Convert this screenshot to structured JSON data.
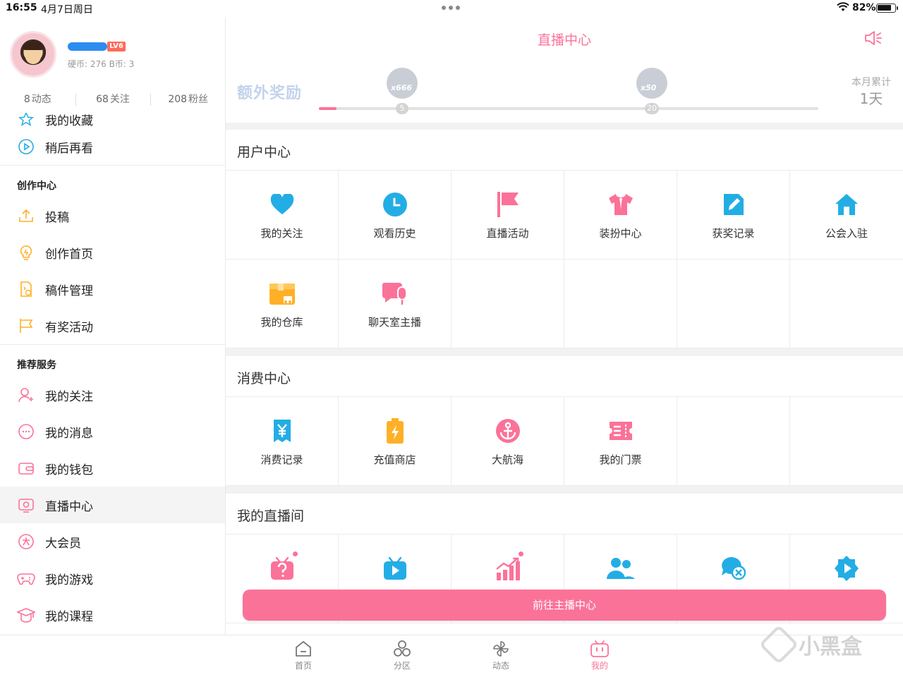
{
  "status_bar": {
    "time": "16:55",
    "date": "4月7日周日",
    "battery_pct": "82%",
    "battery_level": 0.82
  },
  "profile": {
    "level": "LV6",
    "coins": "硬币: 276  B币: 3",
    "stats": [
      {
        "value": "8",
        "label": "动态"
      },
      {
        "value": "68",
        "label": "关注"
      },
      {
        "value": "208",
        "label": "粉丝"
      }
    ]
  },
  "sidebar": {
    "top_items": [
      {
        "label": "我的收藏",
        "icon": "star-icon"
      },
      {
        "label": "稍后再看",
        "icon": "watch-later-icon"
      }
    ],
    "create_group": {
      "title": "创作中心",
      "items": [
        {
          "label": "投稿",
          "icon": "upload-icon"
        },
        {
          "label": "创作首页",
          "icon": "lightbulb-icon"
        },
        {
          "label": "稿件管理",
          "icon": "manuscript-icon"
        },
        {
          "label": "有奖活动",
          "icon": "flag-icon"
        }
      ]
    },
    "recommend_group": {
      "title": "推荐服务",
      "items": [
        {
          "label": "我的关注",
          "icon": "user-plus-icon"
        },
        {
          "label": "我的消息",
          "icon": "message-icon"
        },
        {
          "label": "我的钱包",
          "icon": "wallet-icon"
        },
        {
          "label": "直播中心",
          "icon": "live-tv-icon"
        },
        {
          "label": "大会员",
          "icon": "vip-icon"
        },
        {
          "label": "我的游戏",
          "icon": "gamepad-icon"
        },
        {
          "label": "我的课程",
          "icon": "graduation-cap-icon"
        }
      ]
    }
  },
  "main": {
    "title": "直播中心",
    "reward": {
      "title": "额外奖励",
      "progress": 0.035,
      "milestones": [
        {
          "value": "5",
          "badge": "x666"
        },
        {
          "value": "20",
          "badge": "x50"
        }
      ],
      "monthly_label": "本月累计",
      "monthly_value": "1天"
    },
    "user_center": {
      "title": "用户中心",
      "items": [
        {
          "label": "我的关注",
          "icon": "heart-icon",
          "color": "#23ade5"
        },
        {
          "label": "观看历史",
          "icon": "clock-icon",
          "color": "#23ade5"
        },
        {
          "label": "直播活动",
          "icon": "flag-icon",
          "color": "#fb7299"
        },
        {
          "label": "装扮中心",
          "icon": "shirt-icon",
          "color": "#fb7299"
        },
        {
          "label": "获奖记录",
          "icon": "edit-icon",
          "color": "#23ade5"
        },
        {
          "label": "公会入驻",
          "icon": "house-icon",
          "color": "#23ade5"
        },
        {
          "label": "我的仓库",
          "icon": "warehouse-icon",
          "color": "#ffb027"
        },
        {
          "label": "聊天室主播",
          "icon": "chat-mic-icon",
          "color": "#fb7299"
        }
      ]
    },
    "consume_center": {
      "title": "消费中心",
      "items": [
        {
          "label": "消费记录",
          "icon": "yuan-icon",
          "color": "#23ade5"
        },
        {
          "label": "充值商店",
          "icon": "battery-charge-icon",
          "color": "#ffb027"
        },
        {
          "label": "大航海",
          "icon": "anchor-icon",
          "color": "#fb7299"
        },
        {
          "label": "我的门票",
          "icon": "ticket-icon",
          "color": "#fb7299"
        }
      ]
    },
    "my_live_room": {
      "title": "我的直播间",
      "items": [
        {
          "icon": "question-tv-icon",
          "color": "#fb7299"
        },
        {
          "icon": "play-tv-icon",
          "color": "#23ade5"
        },
        {
          "icon": "chart-up-icon",
          "color": "#fb7299"
        },
        {
          "icon": "group-icon",
          "color": "#23ade5"
        },
        {
          "icon": "chat-blocked-icon",
          "color": "#23ade5"
        },
        {
          "icon": "video-play-icon",
          "color": "#23ade5"
        }
      ]
    },
    "cta_label": "前往主播中心"
  },
  "tabbar": {
    "items": [
      {
        "label": "首页",
        "icon": "home-icon"
      },
      {
        "label": "分区",
        "icon": "category-icon"
      },
      {
        "label": "动态",
        "icon": "pinwheel-icon"
      },
      {
        "label": "我的",
        "icon": "bili-tv-icon"
      }
    ]
  },
  "watermark": {
    "text": "小黑盒"
  },
  "colors": {
    "accent": "#fb7299",
    "blue": "#23ade5",
    "yellow": "#ffb027"
  }
}
